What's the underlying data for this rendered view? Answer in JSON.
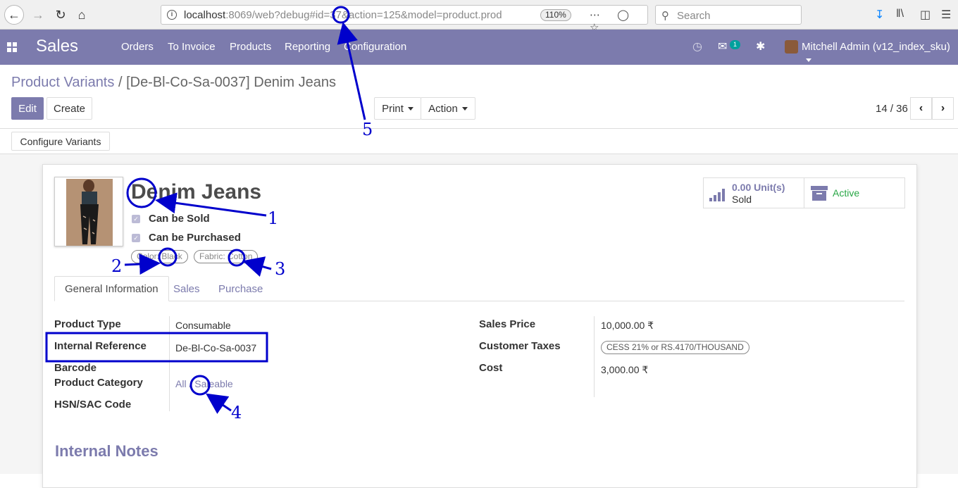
{
  "browser": {
    "url_host": "localhost",
    "url_rest": ":8069/web?debug#id=37&action=125&model=product.prod",
    "zoom": "110%",
    "search_placeholder": "Search"
  },
  "navbar": {
    "brand": "Sales",
    "menu": [
      "Orders",
      "To Invoice",
      "Products",
      "Reporting",
      "Configuration"
    ],
    "message_count": "1",
    "user": "Mitchell Admin (v12_index_sku)"
  },
  "control_panel": {
    "breadcrumb_parent": "Product Variants",
    "breadcrumb_sep": "/",
    "breadcrumb_current": "[De-Bl-Co-Sa-0037] Denim Jeans",
    "edit_label": "Edit",
    "create_label": "Create",
    "print_label": "Print",
    "action_label": "Action",
    "pager": "14 / 36",
    "configure_variants_label": "Configure Variants"
  },
  "product": {
    "name": "Denim Jeans",
    "can_be_sold_label": "Can be Sold",
    "can_be_purchased_label": "Can be Purchased",
    "attributes": [
      "Color: Black",
      "Fabric: Cotton"
    ],
    "sold_value": "0.00 Unit(s)",
    "sold_label": "Sold",
    "active_label": "Active"
  },
  "tabs": [
    "General Information",
    "Sales",
    "Purchase"
  ],
  "fields": {
    "product_type_label": "Product Type",
    "product_type_value": "Consumable",
    "internal_ref_label": "Internal Reference",
    "internal_ref_value": "De-Bl-Co-Sa-0037",
    "barcode_label": "Barcode",
    "category_label": "Product Category",
    "category_value": "All / Saleable",
    "hsn_label": "HSN/SAC Code",
    "sales_price_label": "Sales Price",
    "sales_price_value": "10,000.00 ₹",
    "customer_taxes_label": "Customer Taxes",
    "customer_taxes_value": "CESS 21% or RS.4170/THOUSAND",
    "cost_label": "Cost",
    "cost_value": "3,000.00 ₹"
  },
  "internal_notes_title": "Internal Notes",
  "annotations": [
    "1",
    "2",
    "3",
    "4",
    "5"
  ],
  "colors": {
    "brand": "#7c7bad",
    "annotation": "#0000cc",
    "active": "#28a745"
  }
}
